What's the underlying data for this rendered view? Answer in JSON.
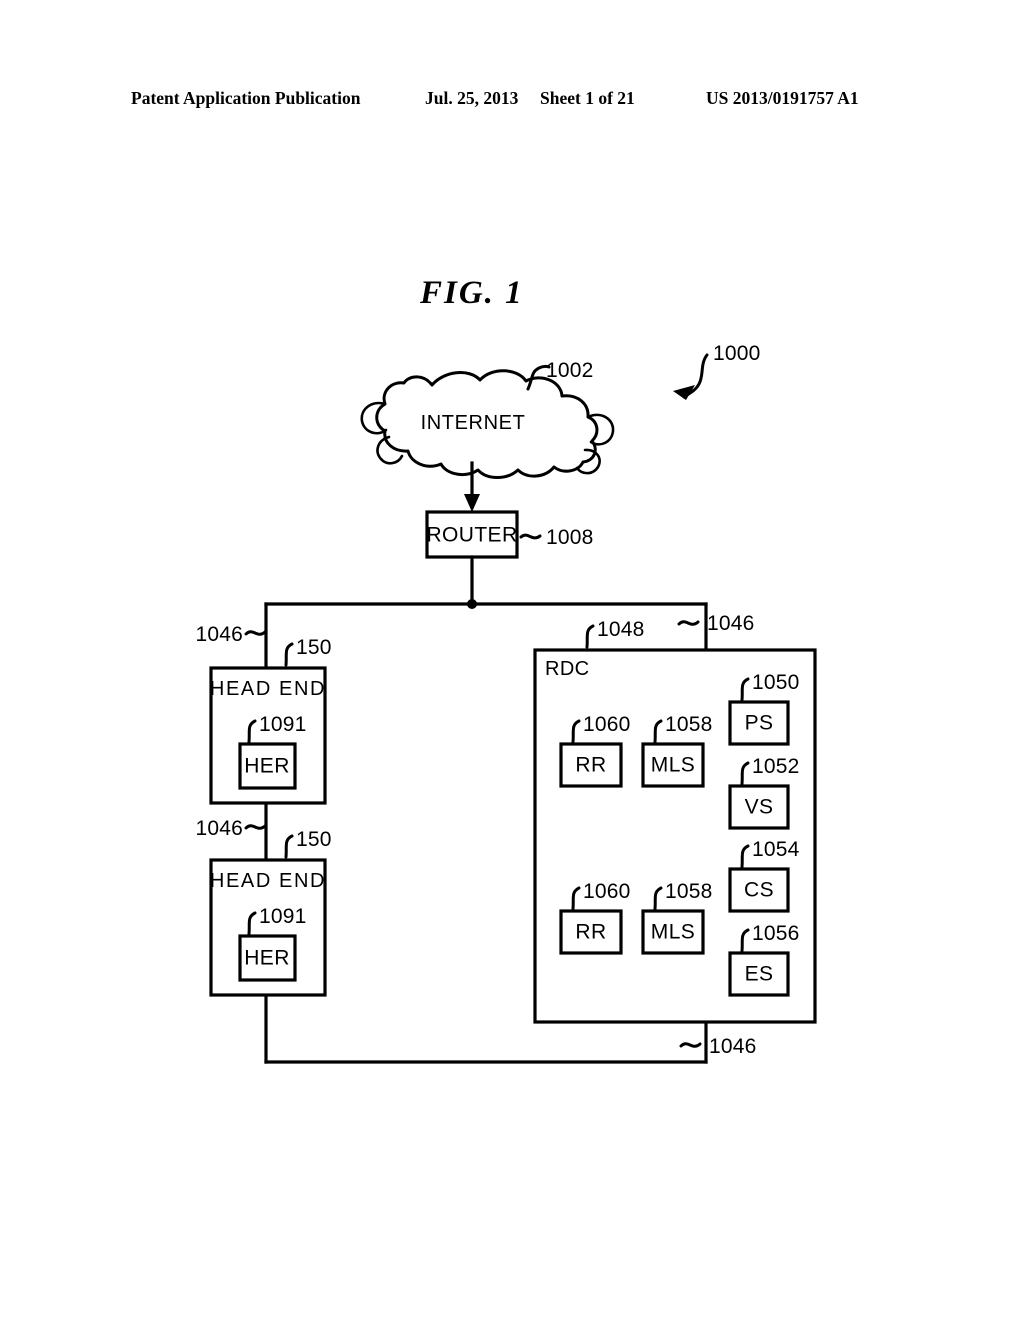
{
  "header": {
    "publication": "Patent Application Publication",
    "date": "Jul. 25, 2013",
    "sheet": "Sheet 1 of 21",
    "patent_number": "US 2013/0191757 A1"
  },
  "figure": {
    "title": "FIG.  1",
    "system_ref": "1000",
    "cloud": {
      "label": "INTERNET",
      "ref": "1002"
    },
    "router": {
      "label": "ROUTER",
      "ref": "1008"
    },
    "bus": {
      "ref_top_left": "1046",
      "ref_top_right": "1046",
      "ref_mid_left": "1046",
      "ref_bottom": "1046"
    },
    "head_ends": [
      {
        "label": "HEAD  END",
        "ref": "150",
        "inner": {
          "label": "HER",
          "ref": "1091"
        }
      },
      {
        "label": "HEAD  END",
        "ref": "150",
        "inner": {
          "label": "HER",
          "ref": "1091"
        }
      }
    ],
    "rdc": {
      "label": "RDC",
      "ref": "1048",
      "components": [
        {
          "label": "RR",
          "ref": "1060"
        },
        {
          "label": "MLS",
          "ref": "1058"
        },
        {
          "label": "PS",
          "ref": "1050"
        },
        {
          "label": "VS",
          "ref": "1052"
        },
        {
          "label": "RR",
          "ref": "1060"
        },
        {
          "label": "MLS",
          "ref": "1058"
        },
        {
          "label": "CS",
          "ref": "1054"
        },
        {
          "label": "ES",
          "ref": "1056"
        }
      ]
    }
  },
  "colors": {
    "ink": "#000000",
    "paper": "#ffffff"
  }
}
